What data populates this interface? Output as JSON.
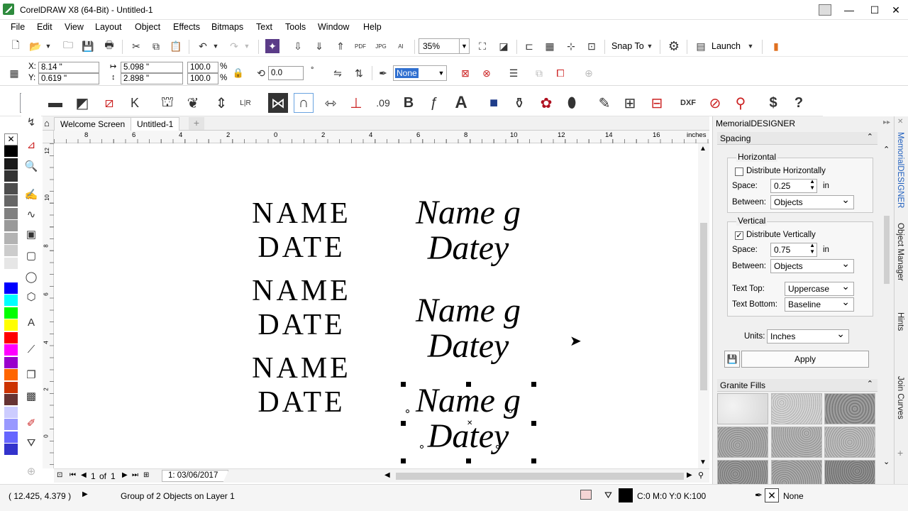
{
  "window": {
    "title": "CorelDRAW X8 (64-Bit) - Untitled-1",
    "controls": [
      "—",
      "☐",
      "✕"
    ]
  },
  "menu": [
    "File",
    "Edit",
    "View",
    "Layout",
    "Object",
    "Effects",
    "Bitmaps",
    "Text",
    "Tools",
    "Window",
    "Help"
  ],
  "toolbar": {
    "zoom": "35%",
    "snap_label": "Snap To",
    "launch_label": "Launch"
  },
  "property_bar": {
    "x": "8.14 \"",
    "y": "0.619 \"",
    "width": "5.098 \"",
    "height": "2.898 \"",
    "scale_x": "100.0",
    "scale_y": "100.0",
    "pct1": "%",
    "pct2": "%",
    "rotation": "0.0",
    "outline": "None",
    "x_label": "X:",
    "y_label": "Y:"
  },
  "tabs": {
    "welcome": "Welcome Screen",
    "doc": "Untitled-1"
  },
  "ruler": {
    "ticks": [
      "8",
      "6",
      "4",
      "2",
      "0",
      "2",
      "4",
      "6",
      "8",
      "10",
      "12",
      "14",
      "16"
    ],
    "unit": "inches",
    "v_ticks": [
      "12",
      "10",
      "8",
      "6",
      "4",
      "2",
      "0"
    ]
  },
  "canvas": {
    "caps_rows": [
      {
        "line1": "NAME",
        "line2": "DATE"
      },
      {
        "line1": "NAME",
        "line2": "DATE"
      },
      {
        "line1": "NAME",
        "line2": "DATE"
      }
    ],
    "mixed_rows": [
      {
        "line1": "Name g",
        "line2": "Datey"
      },
      {
        "line1": "Name g",
        "line2": "Datey"
      },
      {
        "line1": "Name g",
        "line2": "Datey"
      }
    ]
  },
  "page_nav": {
    "current": "1",
    "of": "of",
    "total": "1",
    "page_tab": "1: 03/06/2017"
  },
  "status": {
    "coords": "( 12.425, 4.379 )",
    "selection": "Group of 2 Objects on Layer 1",
    "fill": "C:0 M:0 Y:0 K:100",
    "outline": "None"
  },
  "docker": {
    "title": "MemorialDESIGNER",
    "spacing": {
      "header": "Spacing",
      "horizontal": {
        "title": "Horizontal",
        "distribute_label": "Distribute Horizontally",
        "distribute_checked": false,
        "space_label": "Space:",
        "space_value": "0.25",
        "unit": "in",
        "between_label": "Between:",
        "between_value": "Objects"
      },
      "vertical": {
        "title": "Vertical",
        "distribute_label": "Distribute Vertically",
        "distribute_checked": true,
        "space_label": "Space:",
        "space_value": "0.75",
        "unit": "in",
        "between_label": "Between:",
        "between_value": "Objects",
        "text_top_label": "Text Top:",
        "text_top_value": "Uppercase",
        "text_bottom_label": "Text Bottom:",
        "text_bottom_value": "Baseline"
      },
      "units_label": "Units:",
      "units_value": "Inches",
      "apply_label": "Apply"
    },
    "granite": {
      "header": "Granite Fills"
    }
  },
  "side_tabs": [
    "MemorialDESIGNER",
    "Object Manager",
    "Hints",
    "Join Curves"
  ],
  "palette_colors": [
    "#000000",
    "#1a1a1a",
    "#333333",
    "#4d4d4d",
    "#666666",
    "#808080",
    "#999999",
    "#b3b3b3",
    "#cccccc",
    "#e6e6e6",
    "#ffffff",
    "#0000ff",
    "#00ffff",
    "#00ff00",
    "#ffff00",
    "#ff0000",
    "#ff00ff",
    "#9900cc",
    "#ff6600",
    "#cc3300",
    "#663333",
    "#ccccff",
    "#9999ff",
    "#6666ff",
    "#3333cc"
  ]
}
